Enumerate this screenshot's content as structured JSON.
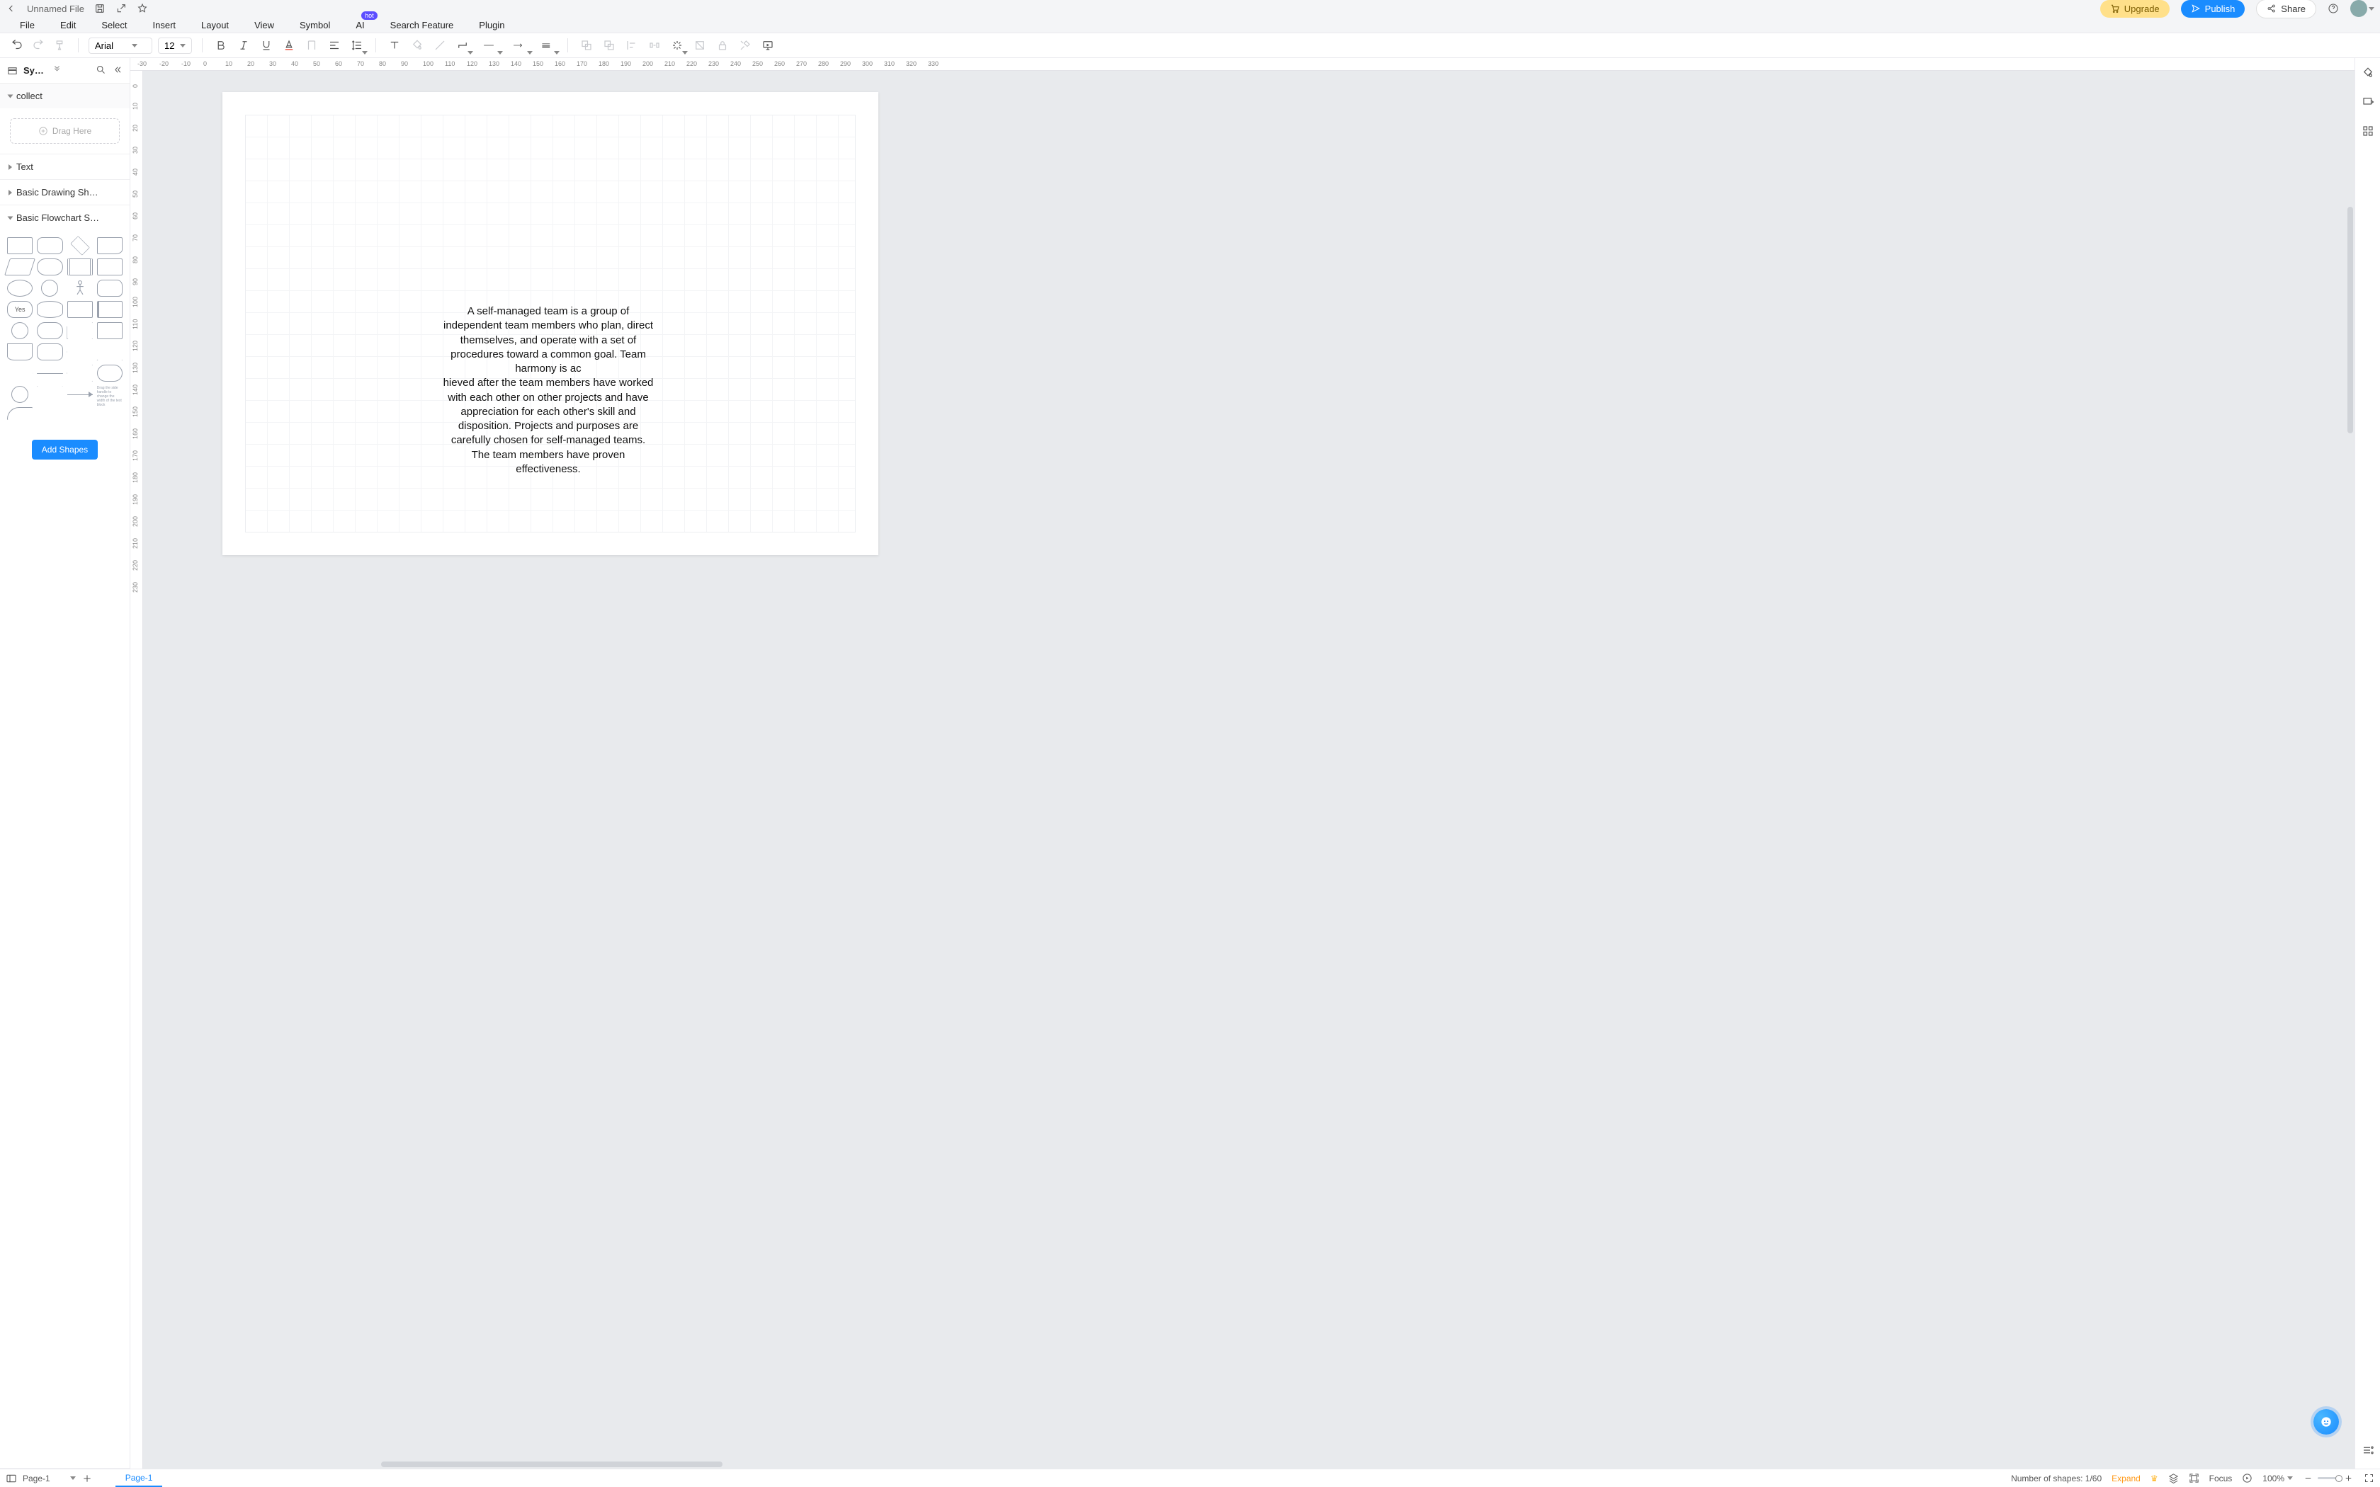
{
  "titlebar": {
    "file_name": "Unnamed File"
  },
  "header_buttons": {
    "upgrade": "Upgrade",
    "publish": "Publish",
    "share": "Share"
  },
  "menu": {
    "file": "File",
    "edit": "Edit",
    "select": "Select",
    "insert": "Insert",
    "layout": "Layout",
    "view": "View",
    "symbol": "Symbol",
    "ai": "AI",
    "ai_badge": "hot",
    "search": "Search Feature",
    "plugin": "Plugin"
  },
  "toolbar": {
    "font_name": "Arial",
    "font_size": "12"
  },
  "left_panel": {
    "header": "Symbol…",
    "collect": "collect",
    "drag_here": "Drag Here",
    "text": "Text",
    "basic_drawing": "Basic Drawing Sh…",
    "basic_flowchart": "Basic Flowchart S…",
    "yes": "Yes",
    "tinytext": "Drag the side handle to change the width of the text block",
    "add_shapes": "Add Shapes"
  },
  "ruler_h": [
    "-30",
    "-20",
    "-10",
    "0",
    "10",
    "20",
    "30",
    "40",
    "50",
    "60",
    "70",
    "80",
    "90",
    "100",
    "110",
    "120",
    "130",
    "140",
    "150",
    "160",
    "170",
    "180",
    "190",
    "200",
    "210",
    "220",
    "230",
    "240",
    "250",
    "260",
    "270",
    "280",
    "290",
    "300",
    "310",
    "320",
    "330"
  ],
  "ruler_v": [
    "0",
    "10",
    "20",
    "30",
    "40",
    "50",
    "60",
    "70",
    "80",
    "90",
    "100",
    "110",
    "120",
    "130",
    "140",
    "150",
    "160",
    "170",
    "180",
    "190",
    "200",
    "210",
    "220",
    "230"
  ],
  "canvas": {
    "text_block": "A self-managed team is a group of independent team members who plan, direct themselves, and operate with a set of procedures toward a common goal. Team harmony is ac\nhieved after the team members have worked with each other on other projects and have appreciation for each other's skill and disposition. Projects and purposes are carefully chosen for self-managed teams. The team members have proven effectiveness."
  },
  "statusbar": {
    "page_select": "Page-1",
    "tab": "Page-1",
    "shapes_label": "Number of shapes: ",
    "shapes_count": "1/60",
    "expand": "Expand",
    "focus": "Focus",
    "zoom": "100%"
  }
}
